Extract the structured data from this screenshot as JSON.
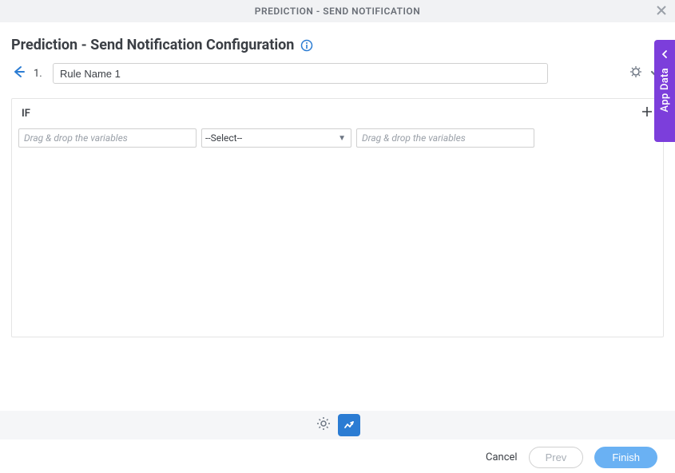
{
  "header": {
    "title": "PREDICTION - SEND NOTIFICATION"
  },
  "page": {
    "title": "Prediction - Send Notification Configuration"
  },
  "rule": {
    "number": "1.",
    "name": "Rule Name 1"
  },
  "condition": {
    "if_label": "IF",
    "left_placeholder": "Drag & drop the variables",
    "select_placeholder": "--Select--",
    "right_placeholder": "Drag & drop the variables"
  },
  "sidepanel": {
    "label": "App Data"
  },
  "footer": {
    "cancel": "Cancel",
    "prev": "Prev",
    "finish": "Finish"
  }
}
